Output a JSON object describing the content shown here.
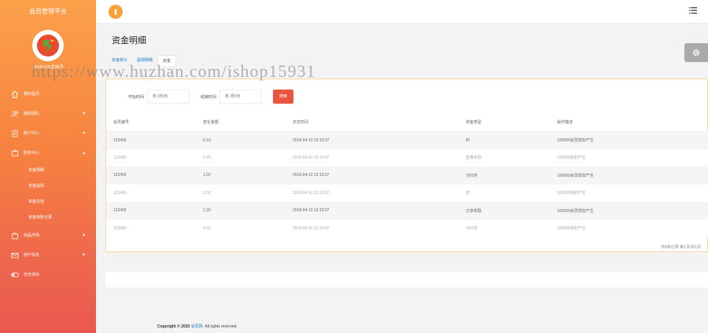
{
  "sidebar": {
    "brand": "会员管理平台",
    "user_line": "123456(会员)账号",
    "menu": [
      {
        "label": "我的首页",
        "icon": "home-icon",
        "caret": ""
      },
      {
        "label": "我的团队",
        "icon": "users-icon",
        "caret": "▾"
      },
      {
        "label": "账户中心",
        "icon": "clipboard-icon",
        "caret": "▾"
      },
      {
        "label": "财务中心",
        "icon": "wallet-icon",
        "caret": "▴"
      }
    ],
    "submenu": [
      "资金明细",
      "资金提现",
      "资金充值",
      "资金转账记录"
    ],
    "menu2": [
      {
        "label": "商品市场",
        "icon": "bag-icon",
        "caret": "▾"
      },
      {
        "label": "用户信息",
        "icon": "mail-icon",
        "caret": "▾"
      },
      {
        "label": "安全退出",
        "icon": "toggle-icon",
        "caret": ""
      }
    ]
  },
  "topbar": {
    "toggle_symbol": "❚"
  },
  "page": {
    "title": "资金明细"
  },
  "tabs": [
    "资金统计",
    "提现明细",
    "资金"
  ],
  "search": {
    "start_label": "开始时间",
    "start_placeholder": "年 /月/日",
    "end_label": "结束时间",
    "end_placeholder": "年 /月/日",
    "button": "搜索"
  },
  "table": {
    "headers": [
      "会员编号",
      "变化金额",
      "日志时间",
      "资金类型",
      "操作描述"
    ],
    "rows": [
      [
        "123456",
        "0.10",
        "2018-04-10 12:10:37",
        "利",
        "100000会员增加产生"
      ],
      [
        "123456",
        "0.40",
        "2018-04-10 12:10:37",
        "直推奖励",
        "100000级别产生"
      ],
      [
        "123456",
        "1.50",
        "2018-04-10 12:10:37",
        "分红奖",
        "100000会员增加产生"
      ],
      [
        "123456",
        "0.30",
        "2018-04-10 12:10:37",
        "奖",
        "100000级别产生"
      ],
      [
        "123456",
        "1.20",
        "2018-04-10 12:10:37",
        "分享奖励",
        "100000会员增加产生"
      ],
      [
        "123456",
        "4.50",
        "2018-04-10 12:10:37",
        "分红奖",
        "100000级别产生"
      ]
    ]
  },
  "pager": "共6条记录 第1页/共1页",
  "footer": {
    "copyright": "Copyright © 2020",
    "brand": "会员网",
    "rights": ". All rights reserved."
  },
  "watermark": "https://www.huzhan.com/ishop15931"
}
